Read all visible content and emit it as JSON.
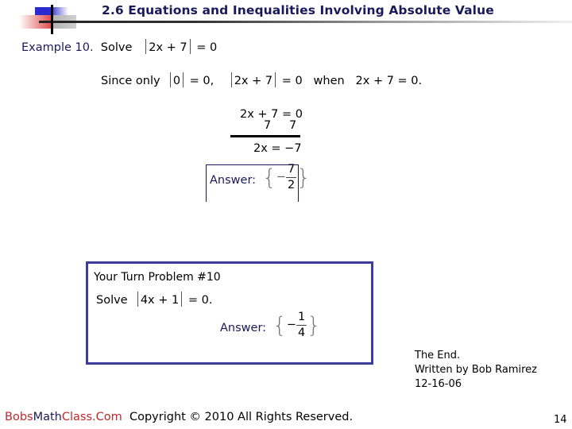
{
  "header": {
    "title": "2.6  Equations and Inequalities Involving Absolute Value"
  },
  "example": {
    "label": "Example 10.",
    "solve_label": "Solve",
    "equation_abs": "2x + 7",
    "equation_rhs": "= 0",
    "since_text": "Since only",
    "since_abs_zero": "0",
    "since_eq_zero": "= 0,",
    "since_abs_expr": "2x + 7",
    "since_eq_zero2": "= 0",
    "when_text": "when",
    "when_equation": "2x + 7 = 0.",
    "work": {
      "line1": "2x + 7 = 0",
      "line2_left": "7",
      "line2_right": "7",
      "line3": "2x = −7"
    },
    "answer_label": "Answer:",
    "answer_sign": "−",
    "answer_numerator": "7",
    "answer_denominator": "2"
  },
  "your_turn": {
    "heading": "Your Turn Problem #10",
    "solve_label": "Solve",
    "equation_abs": "4x + 1",
    "equation_rhs": "= 0.",
    "answer_label": "Answer:",
    "answer_sign": "−",
    "answer_numerator": "1",
    "answer_denominator": "4"
  },
  "end_note": {
    "line1": "The End.",
    "line2": "Written by Bob Ramirez",
    "line3": "12-16-06"
  },
  "footer": {
    "brand_part1": "Bobs",
    "brand_part2": "Math",
    "brand_part3": "Class.Com",
    "copyright": "Copyright © 2010  All Rights Reserved.",
    "page_number": "14"
  },
  "colors": {
    "title": "#1a1a5a",
    "brand_red": "#c0282a",
    "box_border": "#3c3c9c"
  }
}
